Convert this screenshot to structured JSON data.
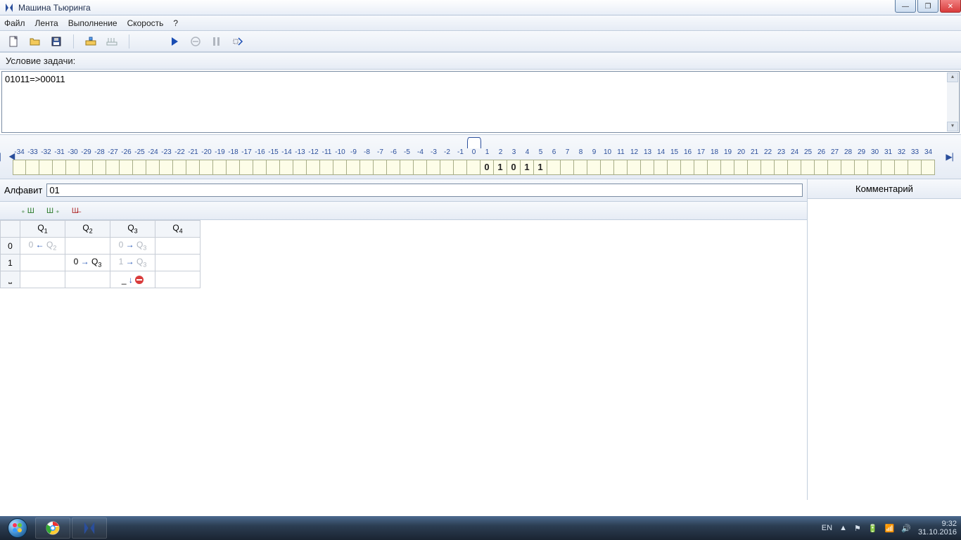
{
  "window": {
    "title": "Машина Тьюринга"
  },
  "menu": {
    "file": "Файл",
    "tape": "Лента",
    "exec": "Выполнение",
    "speed": "Скорость",
    "help": "?"
  },
  "labels": {
    "task": "Условие задачи:",
    "alphabet": "Алфавит",
    "comment": "Комментарий"
  },
  "task_text": "01011=>00011",
  "alphabet_value": "01",
  "tape": {
    "indices_start": -34,
    "indices_end": 34,
    "head_pos": 0,
    "cells": {
      "1": "0",
      "2": "1",
      "3": "0",
      "4": "1",
      "5": "1"
    }
  },
  "table": {
    "states": [
      "Q1",
      "Q2",
      "Q3",
      "Q4"
    ],
    "symbols": [
      "0",
      "1",
      "_"
    ],
    "cells": {
      "0": {
        "Q1": {
          "out": "0",
          "dir": "←",
          "next": "Q2",
          "dim": true
        },
        "Q3": {
          "out": "0",
          "dir": "→",
          "next": "Q3",
          "dim": true
        }
      },
      "1": {
        "Q2": {
          "out": "0",
          "dir": "→",
          "next": "Q3"
        },
        "Q3": {
          "out": "1",
          "dir": "→",
          "next": "Q3",
          "dim": true
        }
      },
      "_": {
        "Q3": {
          "out": "_",
          "dir": "↓",
          "stop": true
        }
      }
    }
  },
  "tray": {
    "lang": "EN",
    "time": "9:32",
    "date": "31.10.2016"
  }
}
